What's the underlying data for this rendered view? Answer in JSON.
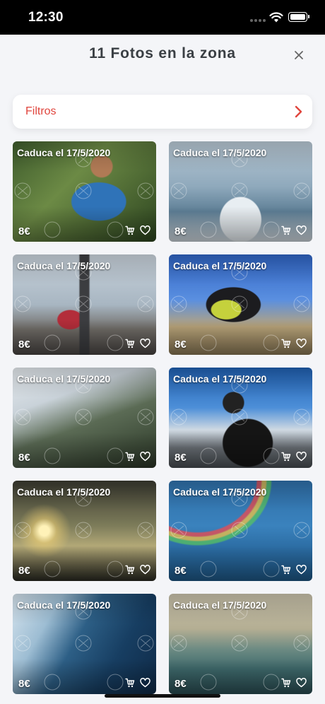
{
  "status_bar": {
    "time": "12:30"
  },
  "header": {
    "title": "11 Fotos en la zona"
  },
  "filters": {
    "label": "Filtros"
  },
  "colors": {
    "accent": "#e0453d",
    "background": "#f4f5f8",
    "title": "#3a3f44"
  },
  "icons": [
    "wifi-icon",
    "battery-icon",
    "close-icon",
    "chevron-right-icon",
    "cart-icon",
    "heart-icon"
  ],
  "photos": [
    {
      "expiry": "Caduca el 17/5/2020",
      "price": "8€",
      "scene": "runner-giving-thumbs-up"
    },
    {
      "expiry": "Caduca el 17/5/2020",
      "price": "8€",
      "scene": "surfers-on-wave"
    },
    {
      "expiry": "Caduca el 17/5/2020",
      "price": "8€",
      "scene": "group-at-eiffel-tower"
    },
    {
      "expiry": "Caduca el 17/5/2020",
      "price": "8€",
      "scene": "mountain-biker-jump"
    },
    {
      "expiry": "Caduca el 17/5/2020",
      "price": "8€",
      "scene": "handstand-machu-picchu"
    },
    {
      "expiry": "Caduca el 17/5/2020",
      "price": "8€",
      "scene": "motorcycle-rider"
    },
    {
      "expiry": "Caduca el 17/5/2020",
      "price": "8€",
      "scene": "climber-silhouette"
    },
    {
      "expiry": "Caduca el 17/5/2020",
      "price": "8€",
      "scene": "kitesurfer-rainbow"
    },
    {
      "expiry": "Caduca el 17/5/2020",
      "price": "8€",
      "scene": "surfer-big-wave"
    },
    {
      "expiry": "Caduca el 17/5/2020",
      "price": "8€",
      "scene": "surfer-sunset-wave"
    }
  ]
}
